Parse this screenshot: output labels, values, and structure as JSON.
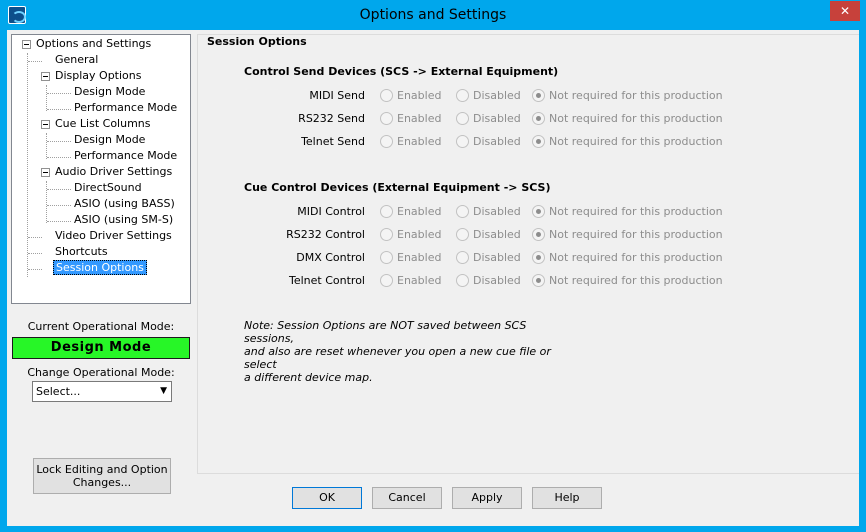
{
  "window": {
    "title": "Options and Settings",
    "close_glyph": "✕"
  },
  "tree": {
    "items": [
      {
        "label": "Options and Settings",
        "level": 0,
        "expanded": true
      },
      {
        "label": "General",
        "level": 1
      },
      {
        "label": "Display Options",
        "level": 1,
        "expanded": true
      },
      {
        "label": "Design Mode",
        "level": 2
      },
      {
        "label": "Performance Mode",
        "level": 2
      },
      {
        "label": "Cue List Columns",
        "level": 1,
        "expanded": true
      },
      {
        "label": "Design Mode",
        "level": 2
      },
      {
        "label": "Performance Mode",
        "level": 2
      },
      {
        "label": "Audio Driver Settings",
        "level": 1,
        "expanded": true
      },
      {
        "label": "DirectSound",
        "level": 2
      },
      {
        "label": "ASIO (using BASS)",
        "level": 2
      },
      {
        "label": "ASIO (using SM-S)",
        "level": 2
      },
      {
        "label": "Video Driver Settings",
        "level": 1
      },
      {
        "label": "Shortcuts",
        "level": 1
      },
      {
        "label": "Session Options",
        "level": 1,
        "selected": true
      }
    ]
  },
  "mode": {
    "current_label": "Current Operational Mode:",
    "current_value": "Design Mode",
    "current_color": "#27f627",
    "change_label": "Change Operational Mode:",
    "select_value": "Select..."
  },
  "lock_button": {
    "line1": "Lock Editing and Option",
    "line2": "Changes..."
  },
  "session": {
    "group_title": "Session Options",
    "send_title": "Control Send Devices (SCS -> External Equipment)",
    "control_title": "Cue Control Devices (External Equipment -> SCS)",
    "options": {
      "enabled": "Enabled",
      "disabled": "Disabled",
      "not_required": "Not required for this production"
    },
    "send_rows": [
      {
        "label": "MIDI Send"
      },
      {
        "label": "RS232 Send"
      },
      {
        "label": "Telnet Send"
      }
    ],
    "control_rows": [
      {
        "label": "MIDI Control"
      },
      {
        "label": "RS232 Control"
      },
      {
        "label": "DMX Control"
      },
      {
        "label": "Telnet Control"
      }
    ],
    "note_lines": [
      "Note: Session Options are NOT saved between SCS sessions,",
      "and also are reset whenever you open a new cue file or select",
      "a different device map."
    ]
  },
  "buttons": {
    "ok": "OK",
    "cancel": "Cancel",
    "apply": "Apply",
    "help": "Help"
  }
}
